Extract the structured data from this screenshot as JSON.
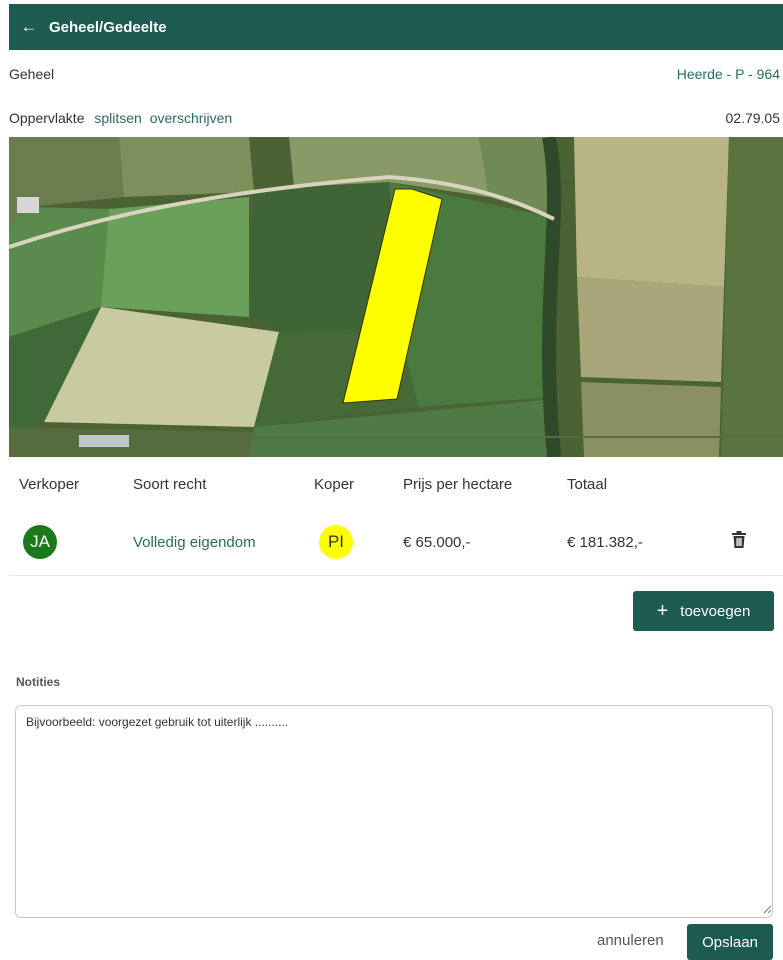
{
  "header": {
    "back_icon": "arrow-left-icon",
    "title": "Geheel/Gedeelte"
  },
  "parcel": {
    "label": "Geheel",
    "code": "Heerde - P - 964",
    "area_label": "Oppervlakte",
    "action_split": "splitsen",
    "action_overwrite": "overschrijven",
    "area_value": "02.79.05"
  },
  "map": {
    "highlight_color": "#ffff00",
    "description": "aerial-map"
  },
  "table": {
    "headers": [
      "Verkoper",
      "Soort recht",
      "Koper",
      "Prijs per hectare",
      "Totaal"
    ],
    "rows": [
      {
        "seller_initials": "JA",
        "seller_color": "#1a7a1a",
        "right_type": "Volledig eigendom",
        "buyer_initials": "PI",
        "buyer_color": "#ffff00",
        "price_per_ha": "€ 65.000,-",
        "total": "€ 181.382,-",
        "delete_icon": "trash-icon"
      }
    ]
  },
  "add_button": {
    "icon": "plus-icon",
    "label": "toevoegen"
  },
  "notes": {
    "label": "Notities",
    "placeholder": "Bijvoorbeeld: voorgezet gebruik tot uiterlijk .........."
  },
  "footer": {
    "cancel_label": "annuleren",
    "save_label": "Opslaan"
  },
  "colors": {
    "primary": "#1d5a50",
    "link": "#2a6a60"
  }
}
